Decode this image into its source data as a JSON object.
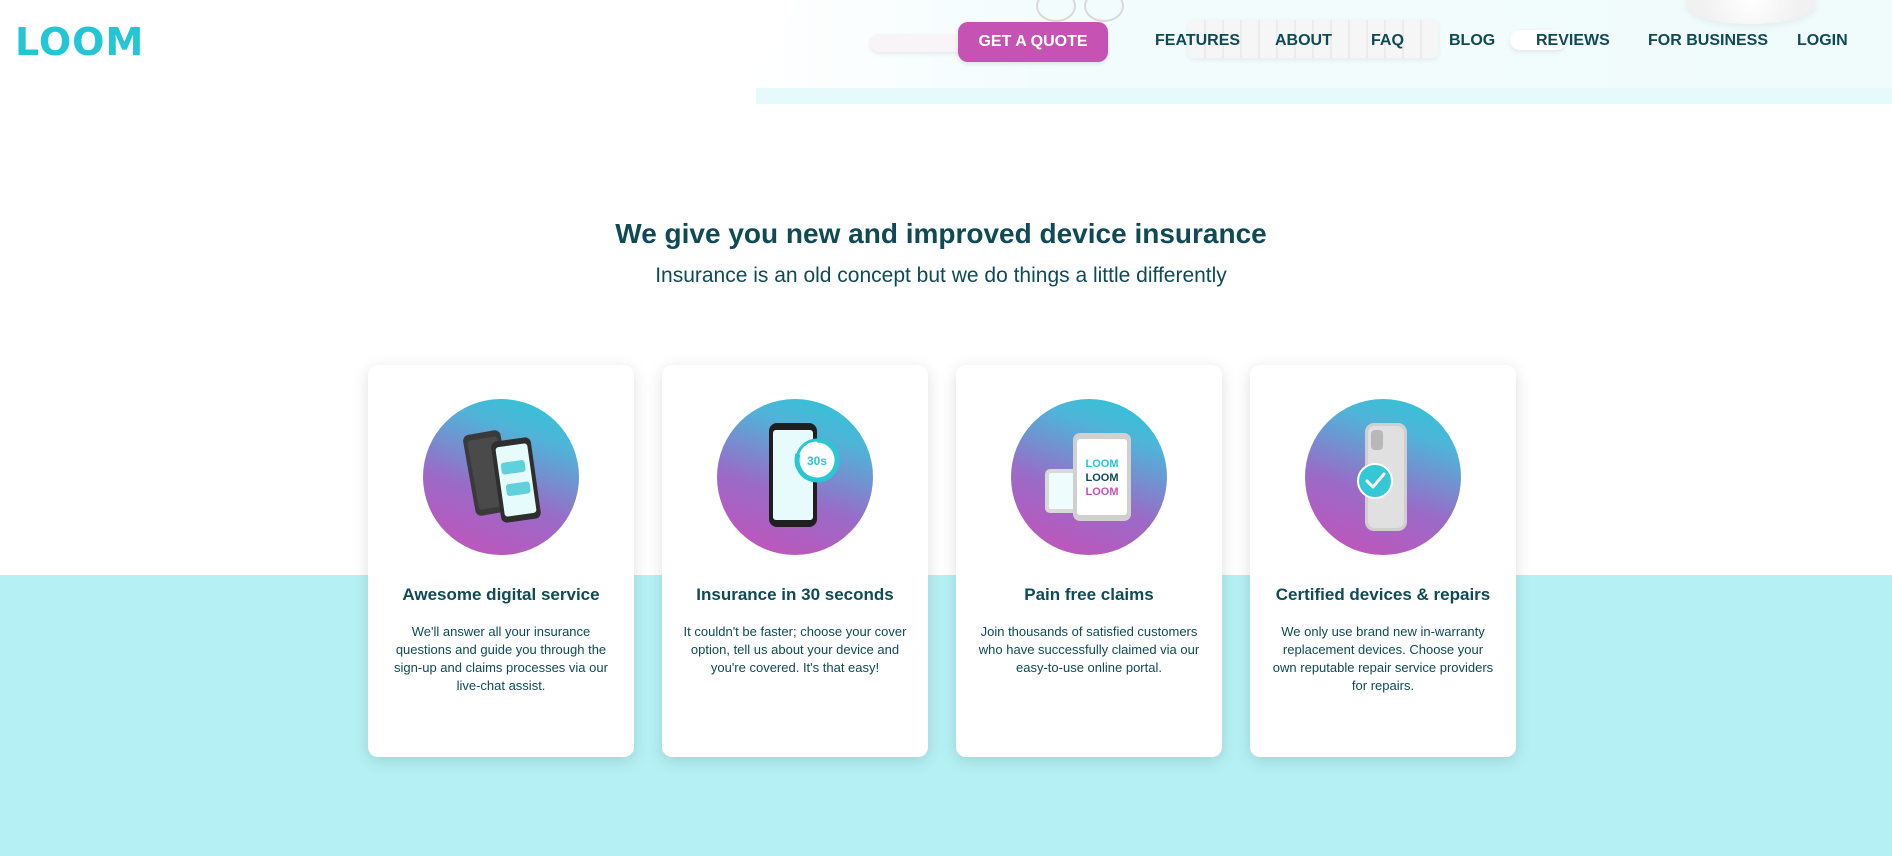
{
  "brand": {
    "logo_text": "LOOM",
    "accent_color": "#23c6d4",
    "cta_color": "#c652b3",
    "text_color": "#0f4a55",
    "band_color": "#b5f1f4"
  },
  "header": {
    "quote_button": "GET A QUOTE",
    "nav": {
      "features": "FEATURES",
      "about": "ABOUT",
      "faq": "FAQ",
      "blog": "BLOG",
      "reviews": "REVIEWS",
      "business": "FOR BUSINESS",
      "login": "LOGIN"
    }
  },
  "hero": {
    "title": "We give you new and improved device insurance",
    "subtitle": "Insurance is an old concept but we do things a little differently"
  },
  "cards": [
    {
      "icon": "phones-chat-icon",
      "title": "Awesome digital service",
      "text": "We'll answer all your insurance questions and guide you through the sign-up and claims processes via our live-chat assist."
    },
    {
      "icon": "phone-timer-icon",
      "title": "Insurance in 30 seconds",
      "text": "It couldn't be faster; choose your cover option, tell us about your device and you're covered. It's that easy!",
      "timer_label": "30s"
    },
    {
      "icon": "phone-tablet-icon",
      "title": "Pain free claims",
      "text": "Join thousands of satisfied customers who have successfully claimed via our easy-to-use online portal.",
      "screen_words": [
        "LOOM",
        "LOOM",
        "LOOM"
      ]
    },
    {
      "icon": "phone-checkmark-icon",
      "title": "Certified devices & repairs",
      "text": "We only use brand new in-warranty replacement devices. Choose your own reputable repair service providers for repairs."
    }
  ]
}
